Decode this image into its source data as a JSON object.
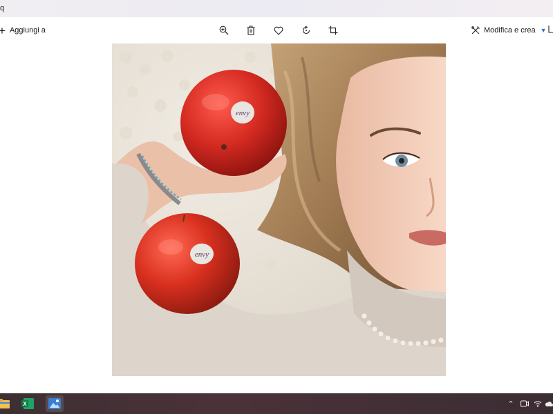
{
  "window": {
    "title_fragment": "q"
  },
  "toolbar": {
    "add_label": "Aggiungi a",
    "edit_label": "Modifica e crea",
    "icons": [
      "zoom-in-icon",
      "delete-icon",
      "favorite-icon",
      "rotate-icon",
      "crop-icon"
    ]
  },
  "photo": {
    "sticker_top": "envy",
    "sticker_bottom": "envy"
  },
  "taskbar": {
    "apps": [
      "file-explorer-icon",
      "excel-icon",
      "photos-icon"
    ],
    "tray": [
      "chevron-up-icon",
      "meet-icon",
      "wifi-icon",
      "cloud-icon"
    ]
  },
  "colors": {
    "accent": "#2a6fd6",
    "taskbar": "#3d2f33",
    "apple_red": "#d42a21",
    "sweater": "#ddd4cb",
    "rug": "#e9e3d9"
  }
}
